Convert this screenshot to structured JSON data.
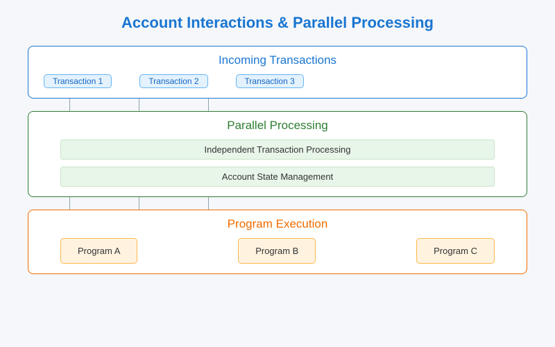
{
  "title": "Account Interactions & Parallel Processing",
  "incoming": {
    "title": "Incoming Transactions",
    "items": [
      "Transaction 1",
      "Transaction 2",
      "Transaction 3"
    ]
  },
  "parallel": {
    "title": "Parallel Processing",
    "bars": [
      "Independent Transaction Processing",
      "Account State Management"
    ]
  },
  "execution": {
    "title": "Program Execution",
    "programs": [
      "Program A",
      "Program B",
      "Program C"
    ]
  }
}
